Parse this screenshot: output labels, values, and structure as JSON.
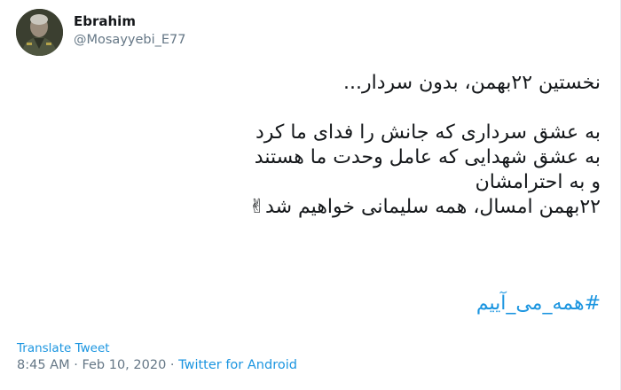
{
  "author": {
    "display_name": "Ebrahim",
    "handle": "@Mosayyebi_E77"
  },
  "tweet": {
    "lines": [
      "نخستین ۲۲بهمن، بدون سردار...",
      "",
      "به عشق سرداری که جانش را فدای ما کرد",
      "به عشق شهدایی که عامل وحدت ما هستند",
      "و به احترامشان",
      "۲۲بهمن امسال، همه سلیمانی خواهیم شد✌"
    ],
    "hashtag": "#همه_می_آییم"
  },
  "footer": {
    "translate_label": "Translate Tweet",
    "time": "8:45 AM",
    "separator": "·",
    "date": "Feb 10, 2020",
    "source": "Twitter for Android"
  },
  "colors": {
    "link": "#1b95e0",
    "muted": "#657786",
    "text": "#14171a"
  }
}
